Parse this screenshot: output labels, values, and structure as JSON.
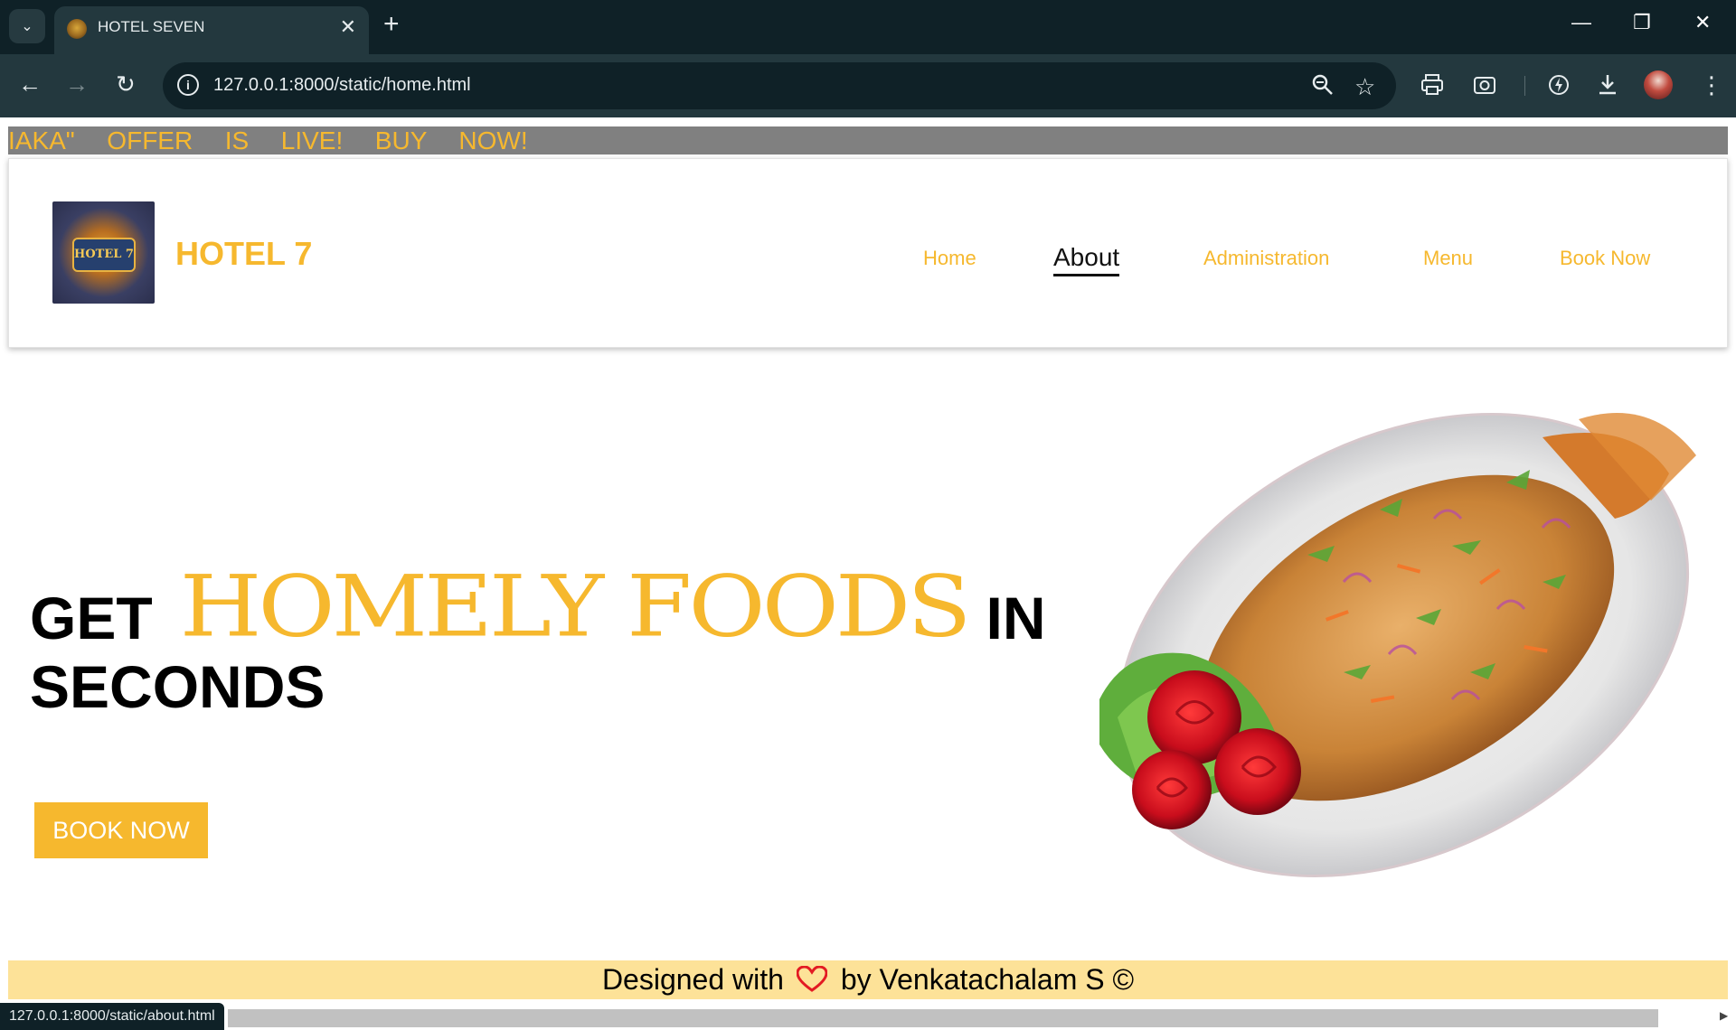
{
  "browser": {
    "tab_title": "HOTEL SEVEN",
    "tab_close": "✕",
    "new_tab": "+",
    "url": "127.0.0.1:8000/static/home.html",
    "status_url": "127.0.0.1:8000/static/about.html",
    "icons": [
      "tab-search-icon",
      "back-arrow-icon",
      "forward-arrow-icon",
      "reload-icon",
      "site-info-icon",
      "zoom-icon",
      "bookmark-star-icon",
      "print-icon",
      "screenshot-icon",
      "performance-icon",
      "download-icon",
      "profile-avatar",
      "kebab-menu-icon",
      "minimize-icon",
      "restore-icon",
      "close-window-icon"
    ]
  },
  "marquee": {
    "text": "IAKA\"  OFFER  IS  LIVE!  BUY  NOW!"
  },
  "header": {
    "brand": "HOTEL 7",
    "logo_text": "HOTEL 7",
    "nav": [
      {
        "label": "Home"
      },
      {
        "label": "About"
      },
      {
        "label": "Administration"
      },
      {
        "label": "Menu"
      },
      {
        "label": "Book Now"
      }
    ]
  },
  "hero": {
    "get": "GET",
    "highlight": "HOMELY FOODS",
    "in": "IN",
    "seconds": "SECONDS",
    "button": "BOOK NOW"
  },
  "footer": {
    "prefix": "Designed with",
    "suffix": "by Venkatachalam S ©"
  },
  "colors": {
    "accent": "#f6b82e",
    "footer_bg": "#fde298",
    "heart": "#e31b23",
    "chrome_dark": "#0f2127",
    "chrome_toolbar": "#23383e"
  }
}
